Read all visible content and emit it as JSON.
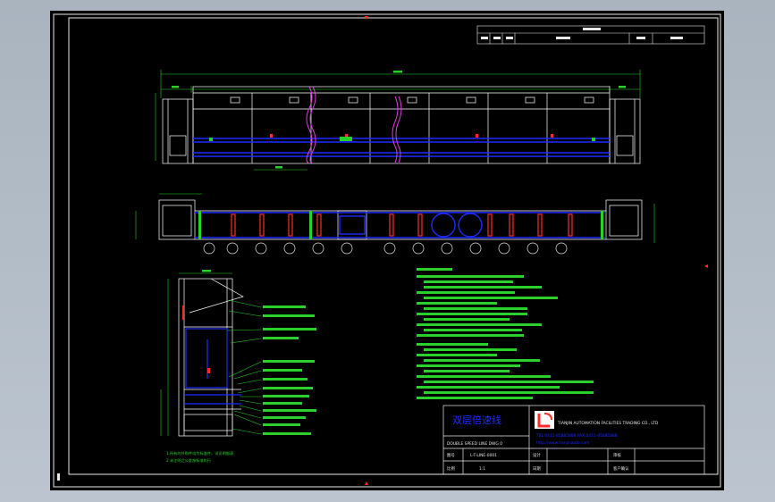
{
  "colors": {
    "frame": "#e8e8e8",
    "geometry": "#ffffff",
    "dimension": "#2bd12b",
    "conveyor": "#1e2bff",
    "accent": "#ff2a2a",
    "highlight": "#e040e0"
  },
  "title_block": {
    "drawing_title": "双层倍速线",
    "company": "TIANJIN AUTOMATION FACILITIES TRADING CO., LTD",
    "tel_fax": "TEL:0411-85885888   FAX:0411-85885888",
    "website": "http://www.tianjinauto.com",
    "subtitle": "DOUBLE SPEED LINE  DWG 0",
    "label_drawing_no": "图号",
    "drawing_no": "L-T-LINE-0001",
    "label_design": "设计",
    "label_review": "审核",
    "label_ratio": "比例",
    "ratio": "1:1",
    "label_date": "日期",
    "label_customer": "客户确认"
  },
  "notes": {
    "left": [
      "1.所有的外购件均为标准件，详见明细表",
      "2.未注明之公差按标准执行"
    ]
  }
}
